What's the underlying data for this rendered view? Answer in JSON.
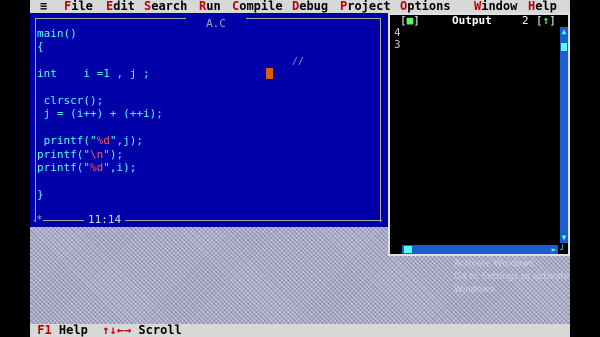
{
  "menubar": {
    "system_glyph": "≡",
    "items": [
      {
        "hot": "F",
        "rest": "ile"
      },
      {
        "hot": "E",
        "rest": "dit"
      },
      {
        "hot": "S",
        "rest": "earch"
      },
      {
        "hot": "R",
        "rest": "un"
      },
      {
        "hot": "C",
        "rest": "ompile"
      },
      {
        "hot": "D",
        "rest": "ebug"
      },
      {
        "hot": "P",
        "rest": "roject"
      },
      {
        "hot": "O",
        "rest": "ptions"
      },
      {
        "hot": "W",
        "rest": "indow"
      },
      {
        "hot": "H",
        "rest": "elp"
      }
    ]
  },
  "editor": {
    "title": "A.C",
    "code_lines": [
      "main()",
      "{",
      "",
      "int    i =1 , j ;",
      "",
      " clrscr();",
      " j = (i++) + (++i);",
      "",
      " printf(\"%d\",j);",
      "printf(\"\\n\");",
      "printf(\"%d\",i);",
      "",
      "}"
    ],
    "comment_mark": "//",
    "corner_glyph": "*",
    "cursor_position": "11:14"
  },
  "output": {
    "close_glyph": "■",
    "title": "Output",
    "window_number": "2",
    "zoom_glyph": "↑",
    "lines": [
      "4",
      "3"
    ]
  },
  "helpbar": {
    "key": "F1",
    "key_label": "Help",
    "arrows": "↑↓←→",
    "arrows_label": "Scroll"
  },
  "watermark": {
    "line1": "Activate Windows",
    "line2": "Go to Settings to activate",
    "line3": "Windows."
  },
  "colors": {
    "editor_bg": "#0000a8",
    "code_text": "#55ffff",
    "string_literal": "#ff5555",
    "menu_bg": "#d8d8d8",
    "hotkey": "#c00000",
    "cursor": "#e05a10"
  }
}
